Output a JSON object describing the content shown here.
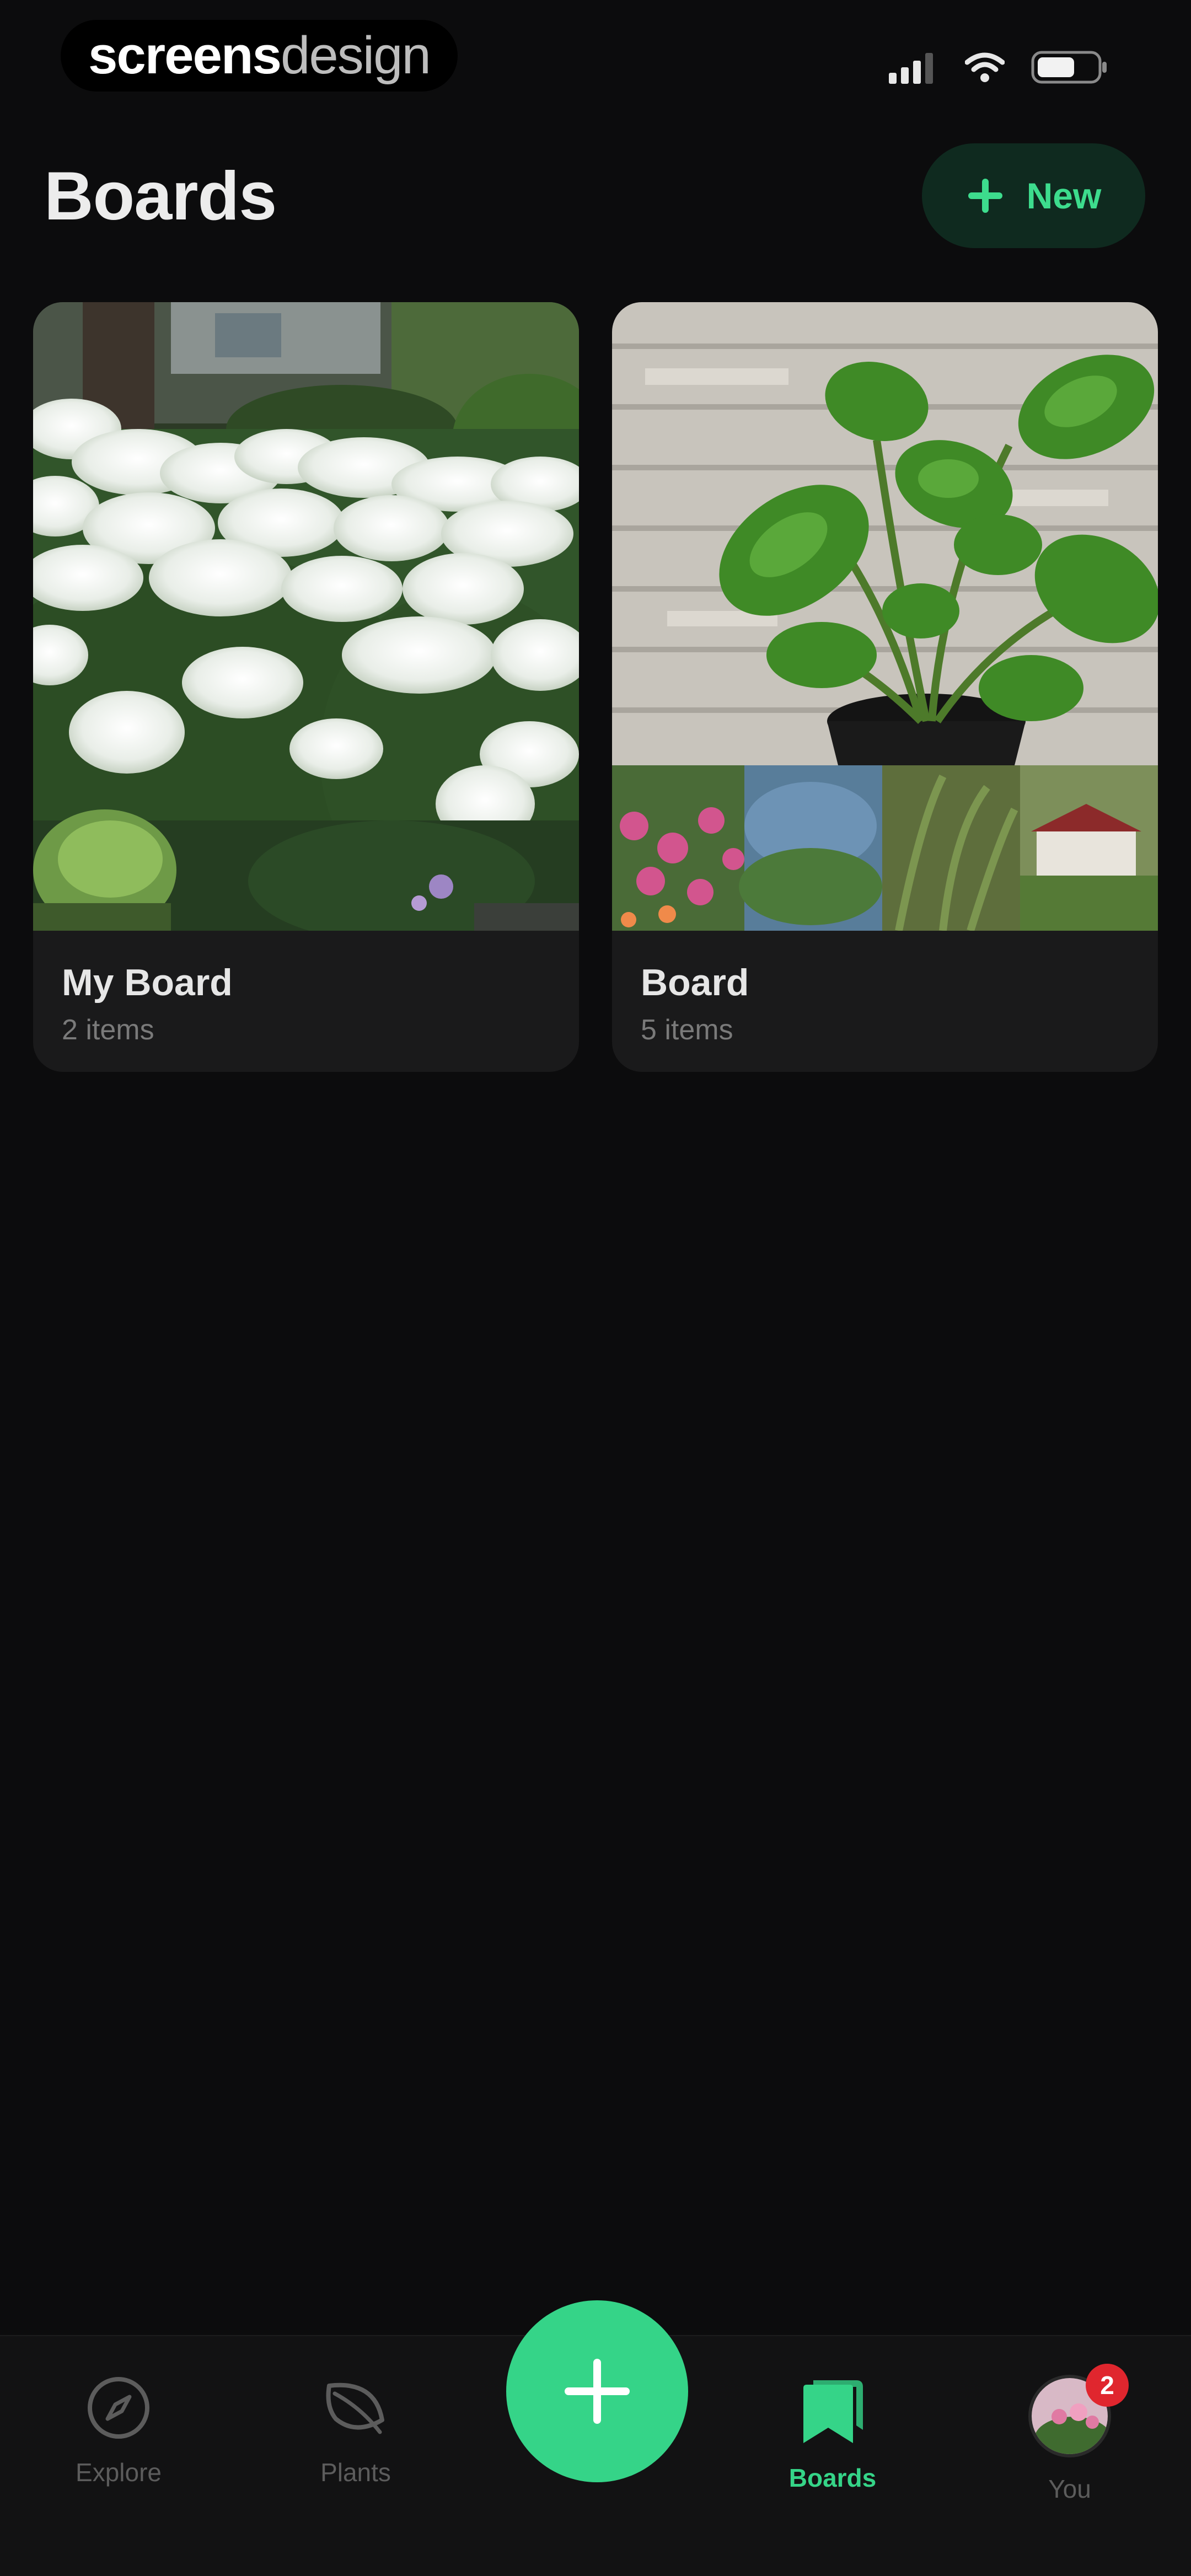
{
  "watermark": {
    "part1": "screens",
    "part2": "design"
  },
  "header": {
    "title": "Boards",
    "new_label": "New"
  },
  "boards": [
    {
      "name": "My Board",
      "count": "2 items"
    },
    {
      "name": "Board",
      "count": "5 items"
    }
  ],
  "tabs": [
    {
      "label": "Explore",
      "icon": "compass-icon"
    },
    {
      "label": "Plants",
      "icon": "leaf-icon"
    },
    {
      "label": "Boards",
      "icon": "bookmark-icon",
      "active": true
    },
    {
      "label": "You",
      "icon": "avatar"
    }
  ],
  "profile": {
    "badge_count": "2"
  },
  "colors": {
    "background": "#0c0c0d",
    "accent": "#35d488",
    "card": "#1a1a1b",
    "badge": "#e0262e"
  }
}
